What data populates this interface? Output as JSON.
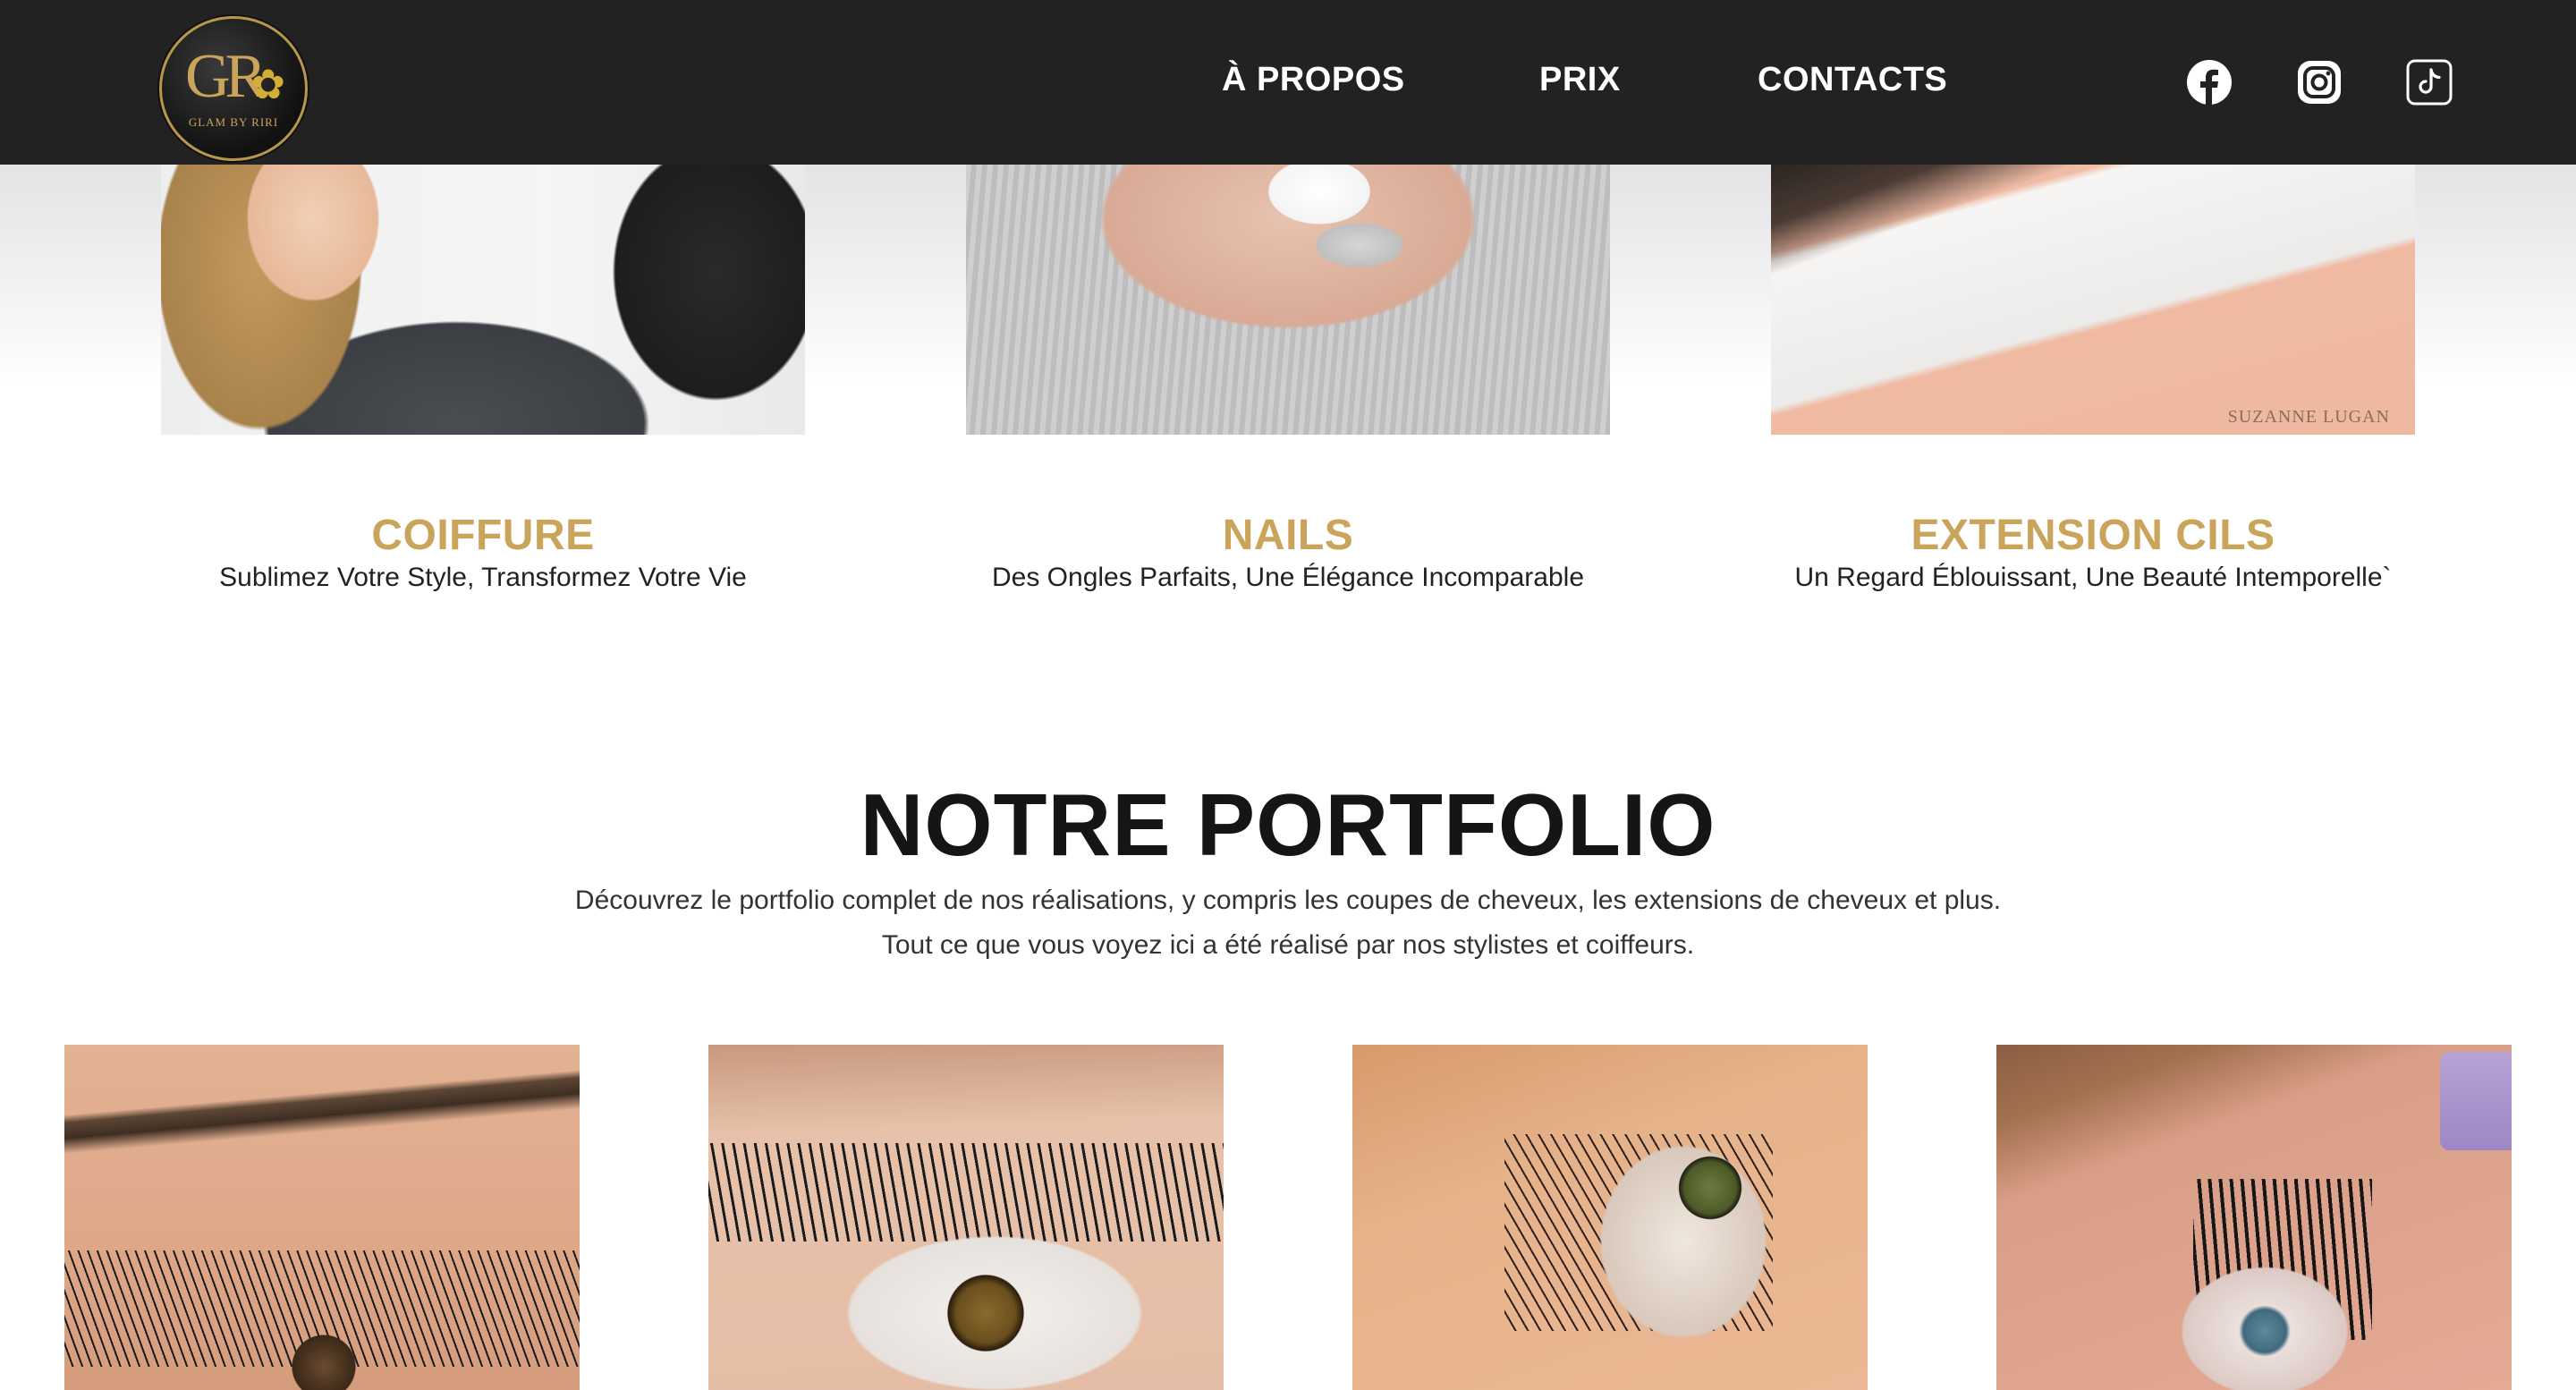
{
  "brand": {
    "monogram": "GR",
    "name": "GLAM BY RIRI"
  },
  "nav": {
    "items": [
      {
        "label": "À PROPOS"
      },
      {
        "label": "PRIX"
      },
      {
        "label": "CONTACTS"
      }
    ],
    "social": [
      {
        "icon": "facebook-icon"
      },
      {
        "icon": "instagram-icon"
      },
      {
        "icon": "tiktok-icon"
      }
    ]
  },
  "services": [
    {
      "title": "COIFFURE",
      "description": "Sublimez Votre Style, Transformez Votre Vie"
    },
    {
      "title": "NAILS",
      "description": "Des Ongles Parfaits, Une Élégance Incomparable"
    },
    {
      "title": "EXTENSION CILS",
      "description": "Un Regard Éblouissant, Une Beauté Intemporelle`",
      "image_watermark": "SUZANNE LUGAN"
    }
  ],
  "portfolio": {
    "title": "NOTRE PORTFOLIO",
    "description": "Découvrez le portfolio complet de nos réalisations, y compris les coupes de cheveux, les extensions de cheveux et plus. Tout ce que vous voyez ici a été réalisé par nos stylistes et coiffeurs."
  },
  "colors": {
    "navbar": "#222222",
    "accent_gold": "#c9a45a",
    "text_dark": "#151515"
  }
}
